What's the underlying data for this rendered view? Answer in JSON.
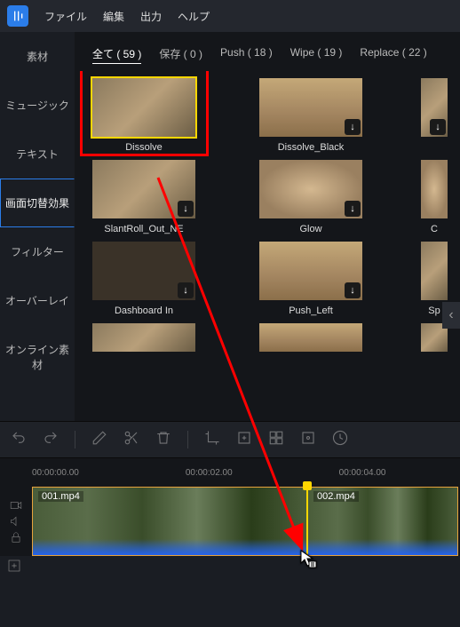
{
  "menu": {
    "file": "ファイル",
    "edit": "編集",
    "output": "出力",
    "help": "ヘルプ"
  },
  "sidebar": {
    "items": [
      "素材",
      "ミュージック",
      "テキスト",
      "画面切替効果",
      "フィルター",
      "オーバーレイ",
      "オンライン素材"
    ],
    "active_index": 3
  },
  "tabs": {
    "all": "全て ( 59 )",
    "saved": "保存 ( 0 )",
    "push": "Push ( 18 )",
    "wipe": "Wipe ( 19 )",
    "replace": "Replace ( 22 )"
  },
  "transitions": {
    "row1": [
      {
        "label": "Dissolve",
        "selected": true,
        "dl": false
      },
      {
        "label": "Dissolve_Black",
        "dl": true
      },
      {
        "label": "",
        "dl": true
      }
    ],
    "row2": [
      {
        "label": "SlantRoll_Out_NE",
        "dl": true
      },
      {
        "label": "Glow",
        "dl": true
      },
      {
        "label": "C",
        "dl": true
      }
    ],
    "row3": [
      {
        "label": "Dashboard In",
        "dl": true
      },
      {
        "label": "Push_Left",
        "dl": true
      },
      {
        "label": "Sp",
        "dl": true
      }
    ],
    "row4": [
      {
        "label": ""
      },
      {
        "label": ""
      },
      {
        "label": ""
      }
    ]
  },
  "ruler": {
    "t0": "00:00:00.00",
    "t1": "00:00:02.00",
    "t2": "00:00:04.00"
  },
  "clips": {
    "c1": "001.mp4",
    "c2": "002.mp4"
  }
}
